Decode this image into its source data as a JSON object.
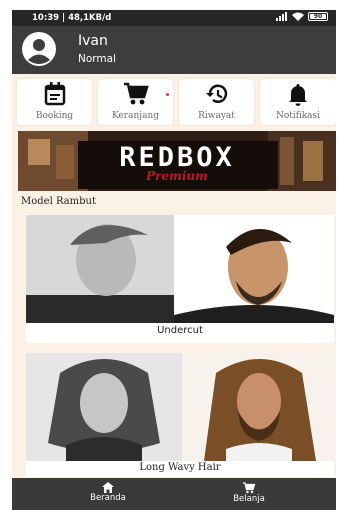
{
  "status_bar": {
    "time": "10:39 | 48,1KB/d",
    "battery": "90"
  },
  "user": {
    "name": "Ivan",
    "tier": "Normal"
  },
  "menu": [
    {
      "label": "Booking",
      "icon": "booking-icon"
    },
    {
      "label": "Keranjang",
      "icon": "cart-icon"
    },
    {
      "label": "Riwayat",
      "icon": "history-icon"
    },
    {
      "label": "Notifikasi",
      "icon": "bell-icon"
    }
  ],
  "banner": {
    "title": "REDBOX",
    "subtitle": "Premium"
  },
  "section_title": "Model Rambut",
  "styles": [
    {
      "name": "Undercut"
    },
    {
      "name": "Long Wavy Hair"
    }
  ],
  "bottom_nav": [
    {
      "label": "Beranda",
      "icon": "home-icon"
    },
    {
      "label": "Belanja",
      "icon": "cart-icon"
    }
  ],
  "colors": {
    "header": "#3d3d3d",
    "background": "#fbf1e4",
    "accent": "#c4162a",
    "nav": "#3a3a3a"
  }
}
